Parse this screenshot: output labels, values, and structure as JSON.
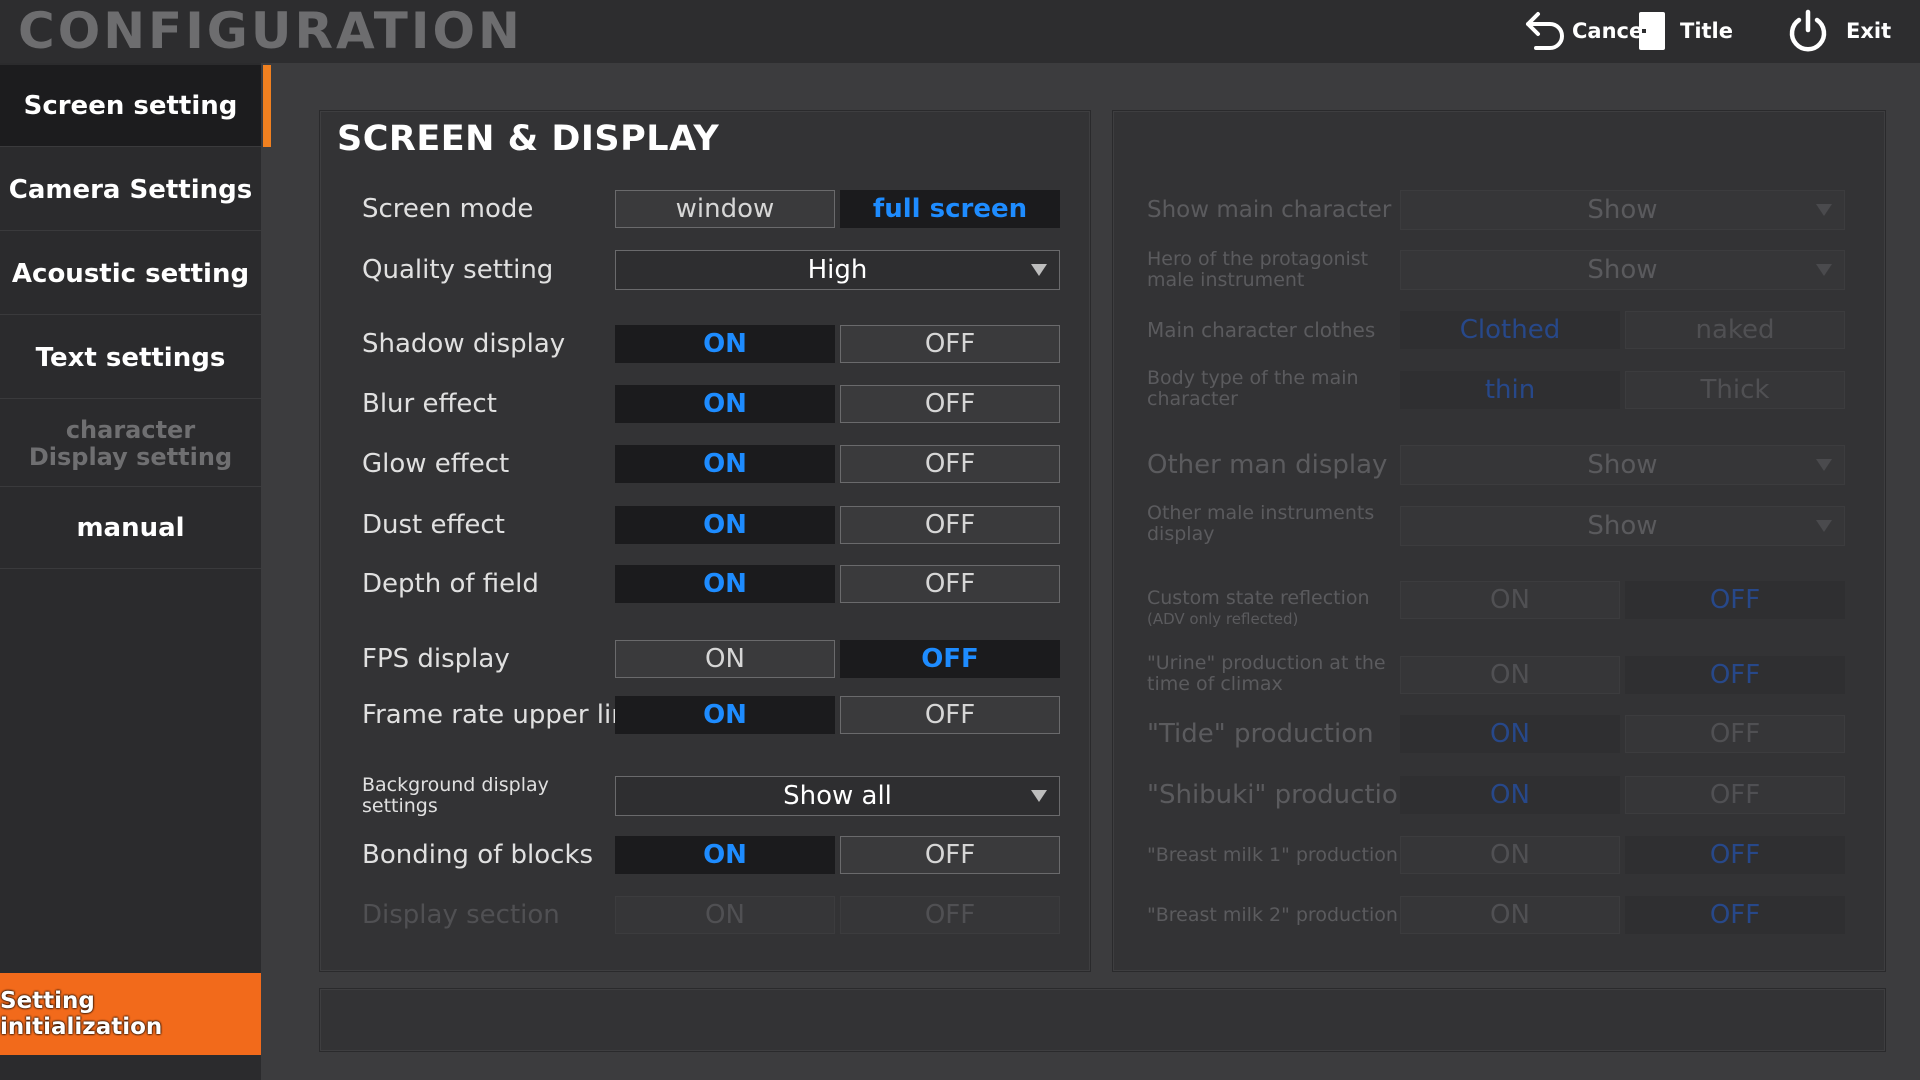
{
  "header": {
    "title": "CONFIGURATION",
    "cancel_label": "Cancel",
    "title_label": "Title",
    "exit_label": "Exit"
  },
  "sidebar": {
    "items": [
      {
        "label": "Screen setting",
        "state": "active"
      },
      {
        "label": "Camera Settings",
        "state": "normal"
      },
      {
        "label": "Acoustic setting",
        "state": "normal"
      },
      {
        "label": "Text settings",
        "state": "normal"
      },
      {
        "label": "character Display setting",
        "state": "disabled"
      },
      {
        "label": "manual",
        "state": "normal"
      }
    ],
    "init_label": "Setting initialization",
    "accent_color": "#f08020"
  },
  "main": {
    "title": "SCREEN & DISPLAY",
    "screen_mode": {
      "label": "Screen mode",
      "opt1": "window",
      "opt2": "full screen",
      "selected": "full screen"
    },
    "quality": {
      "label": "Quality setting",
      "value": "High"
    },
    "shadow": {
      "label": "Shadow display",
      "on": "ON",
      "off": "OFF",
      "selected": "ON"
    },
    "blur": {
      "label": "Blur effect",
      "on": "ON",
      "off": "OFF",
      "selected": "ON"
    },
    "glow": {
      "label": "Glow effect",
      "on": "ON",
      "off": "OFF",
      "selected": "ON"
    },
    "dust": {
      "label": "Dust effect",
      "on": "ON",
      "off": "OFF",
      "selected": "ON"
    },
    "dof": {
      "label": "Depth of field",
      "on": "ON",
      "off": "OFF",
      "selected": "ON"
    },
    "fps": {
      "label": "FPS display",
      "on": "ON",
      "off": "OFF",
      "selected": "OFF"
    },
    "framerate": {
      "label": "Frame rate upper lim",
      "on": "ON",
      "off": "OFF",
      "selected": "ON"
    },
    "background": {
      "label": "Background display settings",
      "value": "Show all"
    },
    "bonding": {
      "label": "Bonding of blocks",
      "on": "ON",
      "off": "OFF",
      "selected": "ON"
    },
    "display_section": {
      "label": "Display section",
      "on": "ON",
      "off": "OFF",
      "enabled": false
    }
  },
  "right": {
    "show_main": {
      "label": "Show main character",
      "value": "Show"
    },
    "hero_instrument": {
      "label": "Hero of the protagonist male instrument",
      "value": "Show"
    },
    "clothes": {
      "label": "Main character clothes",
      "opt1": "Clothed",
      "opt2": "naked",
      "selected": "Clothed"
    },
    "body_type": {
      "label": "Body type of the main character",
      "opt1": "thin",
      "opt2": "Thick",
      "selected": "thin"
    },
    "other_man": {
      "label": "Other man display",
      "value": "Show"
    },
    "other_instruments": {
      "label": "Other male instruments display",
      "value": "Show"
    },
    "custom_state": {
      "label": "Custom state reflection",
      "sublabel": "(ADV only reflected)",
      "on": "ON",
      "off": "OFF",
      "selected": "OFF"
    },
    "urine": {
      "label": "\"Urine\" production at the time of climax",
      "on": "ON",
      "off": "OFF",
      "selected": "OFF"
    },
    "tide": {
      "label": "\"Tide\" production",
      "on": "ON",
      "off": "OFF",
      "selected": "ON"
    },
    "shibuki": {
      "label": "\"Shibuki\" production",
      "on": "ON",
      "off": "OFF",
      "selected": "ON"
    },
    "milk1": {
      "label": "\"Breast milk 1\" production",
      "on": "ON",
      "off": "OFF",
      "selected": "OFF"
    },
    "milk2": {
      "label": "\"Breast milk 2\" production",
      "on": "ON",
      "off": "OFF",
      "selected": "OFF"
    },
    "enabled": false
  },
  "colors": {
    "selected_text": "#1e8cff",
    "init_button": "#f26a1b"
  }
}
